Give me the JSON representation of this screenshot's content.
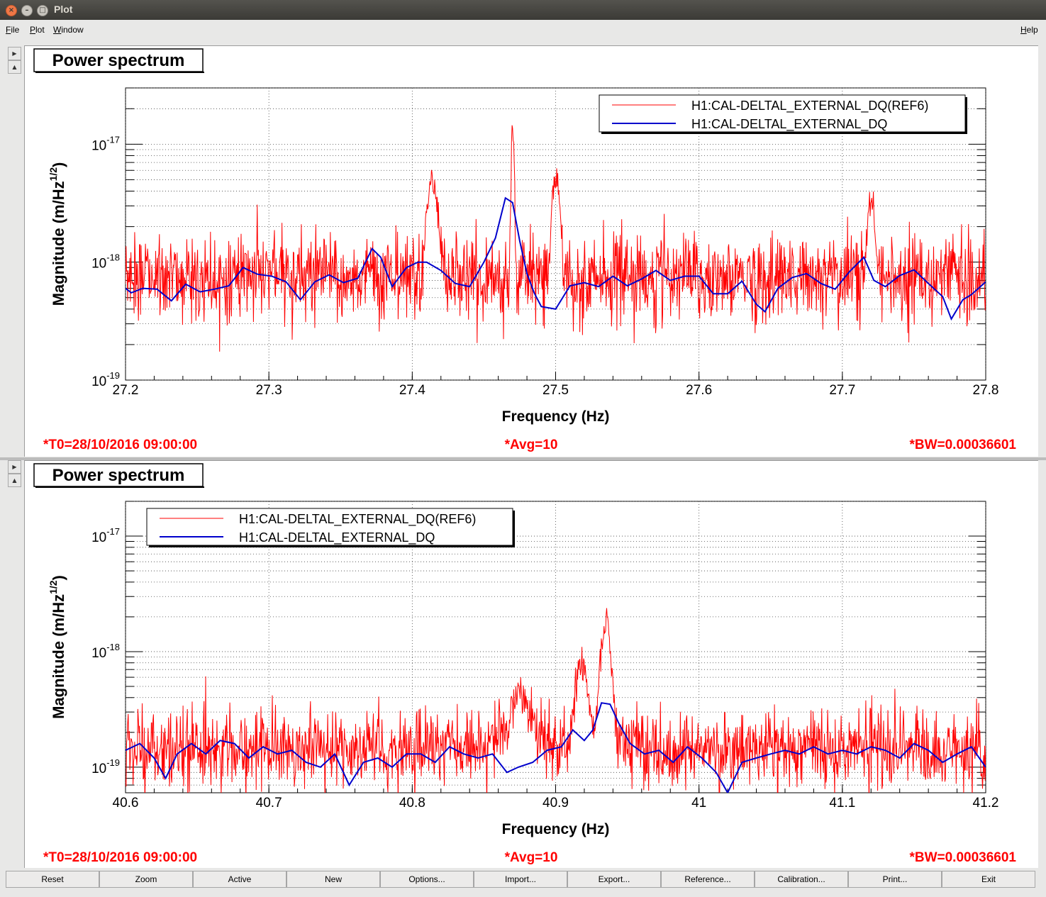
{
  "window": {
    "title": "Plot"
  },
  "menu": {
    "file": "File",
    "plot": "Plot",
    "window": "Window",
    "help": "Help"
  },
  "colors": {
    "reference": "#ff0000",
    "current": "#0000cc",
    "info": "#ff0000"
  },
  "icons": {
    "close": "close-icon",
    "minimize": "minimize-icon",
    "maximize": "maximize-icon",
    "expand": "triangle-right-icon",
    "collapse": "triangle-up-icon"
  },
  "plots": [
    {
      "title": "Power spectrum",
      "footer": {
        "t0": "*T0=28/10/2016 09:00:00",
        "avg": "*Avg=10",
        "bw": "*BW=0.00036601"
      }
    },
    {
      "title": "Power spectrum",
      "footer": {
        "t0": "*T0=28/10/2016 09:00:00",
        "avg": "*Avg=10",
        "bw": "*BW=0.00036601"
      }
    }
  ],
  "chart_data": [
    {
      "type": "line",
      "ylabel": "Magnitude (m/Hz",
      "ylabel_sup": "1/2",
      "ylabel_end": ")",
      "xlabel": "Frequency (Hz)",
      "xlim": [
        27.2,
        27.8
      ],
      "ylim": [
        1e-19,
        3e-17
      ],
      "yscale": "log",
      "xticks": [
        "27.2",
        "27.3",
        "27.4",
        "27.5",
        "27.6",
        "27.7",
        "27.8"
      ],
      "xtick_values": [
        27.2,
        27.3,
        27.4,
        27.5,
        27.6,
        27.7,
        27.8
      ],
      "yticks": [
        {
          "base": "10",
          "exp": "-19",
          "value": 1e-19
        },
        {
          "base": "10",
          "exp": "-18",
          "value": 1e-18
        },
        {
          "base": "10",
          "exp": "-17",
          "value": 1e-17
        }
      ],
      "grid": true,
      "legend_position": "top-right",
      "series": [
        {
          "name": "H1:CAL-DELTAL_EXTERNAL_DQ(REF6)",
          "color": "#ff0000",
          "baseline": 7.5e-19,
          "noise": 0.17,
          "peaks": [
            [
              27.414,
              4.5e-18,
              0.004
            ],
            [
              27.47,
              1.4e-17,
              0.0012
            ],
            [
              27.5,
              5e-18,
              0.003
            ],
            [
              27.72,
              2.7e-18,
              0.003
            ]
          ]
        },
        {
          "name": "H1:CAL-DELTAL_EXTERNAL_DQ",
          "color": "#0000cc",
          "points": [
            [
              27.2,
              6e-19
            ],
            [
              27.204,
              5.5e-19
            ],
            [
              27.212,
              6e-19
            ],
            [
              27.222,
              5.9e-19
            ],
            [
              27.232,
              4.7e-19
            ],
            [
              27.242,
              6.5e-19
            ],
            [
              27.252,
              5.6e-19
            ],
            [
              27.262,
              5.9e-19
            ],
            [
              27.272,
              6.3e-19
            ],
            [
              27.282,
              9e-19
            ],
            [
              27.292,
              7.9e-19
            ],
            [
              27.302,
              7.6e-19
            ],
            [
              27.312,
              6.8e-19
            ],
            [
              27.322,
              4.8e-19
            ],
            [
              27.332,
              6.8e-19
            ],
            [
              27.342,
              7.8e-19
            ],
            [
              27.352,
              6.7e-19
            ],
            [
              27.362,
              7.3e-19
            ],
            [
              27.372,
              1.3e-18
            ],
            [
              27.378,
              1.1e-18
            ],
            [
              27.386,
              6.2e-19
            ],
            [
              27.396,
              9e-19
            ],
            [
              27.404,
              1e-18
            ],
            [
              27.41,
              1e-18
            ],
            [
              27.42,
              8.5e-19
            ],
            [
              27.43,
              6.6e-19
            ],
            [
              27.44,
              6.2e-19
            ],
            [
              27.45,
              1e-18
            ],
            [
              27.458,
              1.6e-18
            ],
            [
              27.465,
              3.5e-18
            ],
            [
              27.47,
              3.2e-18
            ],
            [
              27.475,
              1.5e-18
            ],
            [
              27.48,
              8e-19
            ],
            [
              27.485,
              5.5e-19
            ],
            [
              27.49,
              4.2e-19
            ],
            [
              27.5,
              4e-19
            ],
            [
              27.51,
              6.3e-19
            ],
            [
              27.52,
              6.7e-19
            ],
            [
              27.53,
              6.2e-19
            ],
            [
              27.54,
              7.6e-19
            ],
            [
              27.55,
              6.3e-19
            ],
            [
              27.56,
              7.2e-19
            ],
            [
              27.57,
              8.5e-19
            ],
            [
              27.58,
              7e-19
            ],
            [
              27.59,
              7.6e-19
            ],
            [
              27.6,
              7.6e-19
            ],
            [
              27.61,
              5.4e-19
            ],
            [
              27.62,
              5.4e-19
            ],
            [
              27.63,
              6.9e-19
            ],
            [
              27.64,
              4.4e-19
            ],
            [
              27.646,
              3.8e-19
            ],
            [
              27.655,
              6e-19
            ],
            [
              27.665,
              7.4e-19
            ],
            [
              27.675,
              8e-19
            ],
            [
              27.685,
              6.6e-19
            ],
            [
              27.695,
              5.9e-19
            ],
            [
              27.705,
              8.3e-19
            ],
            [
              27.715,
              1.1e-18
            ],
            [
              27.722,
              7e-19
            ],
            [
              27.73,
              6.2e-19
            ],
            [
              27.74,
              7.7e-19
            ],
            [
              27.75,
              8.6e-19
            ],
            [
              27.76,
              6.6e-19
            ],
            [
              27.77,
              5.1e-19
            ],
            [
              27.776,
              3.3e-19
            ],
            [
              27.784,
              4.8e-19
            ],
            [
              27.79,
              5.3e-19
            ],
            [
              27.8,
              6.8e-19
            ]
          ]
        }
      ]
    },
    {
      "type": "line",
      "ylabel": "Magnitude (m/Hz",
      "ylabel_sup": "1/2",
      "ylabel_end": ")",
      "xlabel": "Frequency (Hz)",
      "xlim": [
        40.6,
        41.2
      ],
      "ylim": [
        6e-20,
        2e-17
      ],
      "yscale": "log",
      "xticks": [
        "40.6",
        "40.7",
        "40.8",
        "40.9",
        "41",
        "41.1",
        "41.2"
      ],
      "xtick_values": [
        40.6,
        40.7,
        40.8,
        40.9,
        41.0,
        41.1,
        41.2
      ],
      "yticks": [
        {
          "base": "10",
          "exp": "-19",
          "value": 1e-19
        },
        {
          "base": "10",
          "exp": "-18",
          "value": 1e-18
        },
        {
          "base": "10",
          "exp": "-17",
          "value": 1e-17
        }
      ],
      "grid": true,
      "legend_position": "top-left",
      "series": [
        {
          "name": "H1:CAL-DELTAL_EXTERNAL_DQ(REF6)",
          "color": "#ff0000",
          "baseline": 1.45e-19,
          "noise": 0.15,
          "peaks": [
            [
              40.875,
              3.5e-19,
              0.008
            ],
            [
              40.918,
              7e-19,
              0.005
            ],
            [
              40.935,
              1.9e-18,
              0.004
            ]
          ]
        },
        {
          "name": "H1:CAL-DELTAL_EXTERNAL_DQ",
          "color": "#0000cc",
          "points": [
            [
              40.6,
              1.4e-19
            ],
            [
              40.61,
              1.6e-19
            ],
            [
              40.62,
              1.2e-19
            ],
            [
              40.628,
              8e-20
            ],
            [
              40.636,
              1.3e-19
            ],
            [
              40.646,
              1.6e-19
            ],
            [
              40.656,
              1.3e-19
            ],
            [
              40.666,
              1.7e-19
            ],
            [
              40.676,
              1.6e-19
            ],
            [
              40.686,
              1.2e-19
            ],
            [
              40.696,
              1.5e-19
            ],
            [
              40.706,
              1.3e-19
            ],
            [
              40.716,
              1.4e-19
            ],
            [
              40.726,
              1.1e-19
            ],
            [
              40.736,
              1e-19
            ],
            [
              40.746,
              1.3e-19
            ],
            [
              40.756,
              7e-20
            ],
            [
              40.766,
              1.1e-19
            ],
            [
              40.776,
              1.2e-19
            ],
            [
              40.786,
              1e-19
            ],
            [
              40.796,
              1.3e-19
            ],
            [
              40.806,
              1.3e-19
            ],
            [
              40.816,
              1.1e-19
            ],
            [
              40.826,
              1.5e-19
            ],
            [
              40.836,
              1.3e-19
            ],
            [
              40.846,
              1.2e-19
            ],
            [
              40.856,
              1.3e-19
            ],
            [
              40.866,
              9e-20
            ],
            [
              40.874,
              1e-19
            ],
            [
              40.884,
              1.1e-19
            ],
            [
              40.894,
              1.4e-19
            ],
            [
              40.904,
              1.5e-19
            ],
            [
              40.912,
              2.1e-19
            ],
            [
              40.92,
              1.7e-19
            ],
            [
              40.926,
              2.1e-19
            ],
            [
              40.932,
              3.6e-19
            ],
            [
              40.938,
              3.5e-19
            ],
            [
              40.944,
              2.4e-19
            ],
            [
              40.952,
              1.6e-19
            ],
            [
              40.962,
              1.3e-19
            ],
            [
              40.972,
              1.4e-19
            ],
            [
              40.982,
              1.1e-19
            ],
            [
              40.992,
              1.5e-19
            ],
            [
              41.002,
              1.2e-19
            ],
            [
              41.012,
              9e-20
            ],
            [
              41.02,
              6e-20
            ],
            [
              41.03,
              1.1e-19
            ],
            [
              41.04,
              1.2e-19
            ],
            [
              41.05,
              1.3e-19
            ],
            [
              41.06,
              1.4e-19
            ],
            [
              41.07,
              1.3e-19
            ],
            [
              41.08,
              1.5e-19
            ],
            [
              41.09,
              1.3e-19
            ],
            [
              41.1,
              1.4e-19
            ],
            [
              41.11,
              1.3e-19
            ],
            [
              41.12,
              1.5e-19
            ],
            [
              41.13,
              1.4e-19
            ],
            [
              41.14,
              1.2e-19
            ],
            [
              41.15,
              1.6e-19
            ],
            [
              41.16,
              1.4e-19
            ],
            [
              41.17,
              1.1e-19
            ],
            [
              41.18,
              1.3e-19
            ],
            [
              41.19,
              1.5e-19
            ],
            [
              41.2,
              1e-19
            ]
          ]
        }
      ]
    }
  ],
  "toolbar": [
    "Reset",
    "Zoom",
    "Active",
    "New",
    "Options...",
    "Import...",
    "Export...",
    "Reference...",
    "Calibration...",
    "Print...",
    "Exit"
  ]
}
